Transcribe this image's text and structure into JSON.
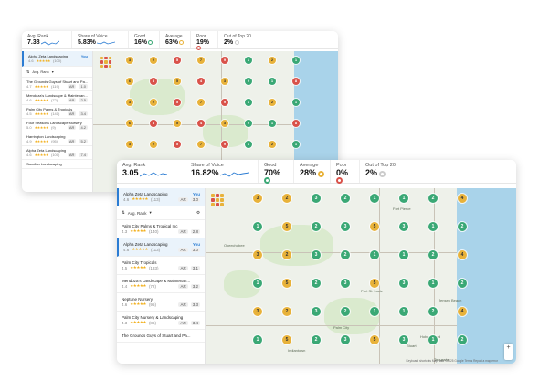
{
  "back": {
    "stats": [
      {
        "label": "Avg. Rank",
        "value": "7.38"
      },
      {
        "label": "Share of Voice",
        "value": "5.83%"
      },
      {
        "label": "Good",
        "value": "16%"
      },
      {
        "label": "Average",
        "value": "63%"
      },
      {
        "label": "Poor",
        "value": "19%"
      },
      {
        "label": "Out of Top 20",
        "value": "2%"
      }
    ],
    "selected": {
      "name": "Alpha Zeta Landscaping",
      "you": "You",
      "rating": "4.6",
      "reviews": "(100)"
    },
    "sort_label": "Avg. Rank",
    "list": [
      {
        "name": "The Grounds Guys of Stuart and Pa...",
        "rating": "4.7",
        "reviews": "(119)",
        "ar": "AR",
        "rank": "1.0"
      },
      {
        "name": "Mendoza's Landscape & Maintenan...",
        "rating": "4.6",
        "reviews": "(72)",
        "ar": "AR",
        "rank": "2.5"
      },
      {
        "name": "Palm City Palms & Tropicals",
        "rating": "4.5",
        "reviews": "(141)",
        "ar": "AR",
        "rank": "3.4"
      },
      {
        "name": "Four Seasons Landscape Nursery",
        "rating": "5.0",
        "reviews": "(9)",
        "ar": "AR",
        "rank": "4.2"
      },
      {
        "name": "Harrington Landscaping",
        "rating": "4.9",
        "reviews": "(95)",
        "ar": "AR",
        "rank": "5.2"
      },
      {
        "name": "Alpha Zeta Landscaping",
        "rating": "4.6",
        "reviews": "(100)",
        "ar": "AR",
        "rank": "7.4"
      },
      {
        "name": "Sarafinn Landscaping",
        "rating": "",
        "reviews": "",
        "ar": "",
        "rank": ""
      }
    ]
  },
  "front": {
    "stats": [
      {
        "label": "Avg. Rank",
        "value": "3.05"
      },
      {
        "label": "Share of Voice",
        "value": "16.82%"
      },
      {
        "label": "Good",
        "value": "70%"
      },
      {
        "label": "Average",
        "value": "28%"
      },
      {
        "label": "Poor",
        "value": "0%"
      },
      {
        "label": "Out of Top 20",
        "value": "2%"
      }
    ],
    "selected": {
      "name": "Alpha Zeta Landscaping",
      "you": "You",
      "rating": "4.6",
      "reviews": "(113)",
      "ar": "AR",
      "rank": "3.0"
    },
    "sort_label": "Avg. Rank",
    "list": [
      {
        "name": "Palm City Palms & Tropical Inc",
        "rating": "4.3",
        "reviews": "(140)",
        "ar": "AR",
        "rank": "2.8",
        "sel": false
      },
      {
        "name": "Alpha Zeta Landscaping",
        "rating": "4.6",
        "reviews": "(113)",
        "ar": "AR",
        "rank": "3.0",
        "sel": true,
        "you": "You"
      },
      {
        "name": "Palm City Tropicals",
        "rating": "4.5",
        "reviews": "(133)",
        "ar": "AR",
        "rank": "3.1",
        "sel": false
      },
      {
        "name": "Mendoza's Landscape & Maintenan...",
        "rating": "4.4",
        "reviews": "(72)",
        "ar": "AR",
        "rank": "3.2",
        "sel": false
      },
      {
        "name": "Neptune Nursery",
        "rating": "4.6",
        "reviews": "(95)",
        "ar": "AR",
        "rank": "3.3",
        "sel": false
      },
      {
        "name": "Palm City Nursery & Landscaping",
        "rating": "4.3",
        "reviews": "(86)",
        "ar": "AR",
        "rank": "3.4",
        "sel": false
      },
      {
        "name": "The Grounds Guys of Stuart and Pa...",
        "rating": "",
        "reviews": "",
        "ar": "",
        "rank": "",
        "sel": false
      }
    ],
    "map_labels": [
      "Fort Pierce",
      "Port St. Lucie",
      "Stuart",
      "Palm City",
      "Indiantown",
      "Jensen Beach",
      "Hobe Sound",
      "Tequesta",
      "Okeechobee"
    ],
    "footer": "Keyboard shortcuts   Map data ©2025 Google   Terms   Report a map error",
    "zoom_in": "+",
    "zoom_out": "−"
  },
  "colors": {
    "good": "#3aa875",
    "average": "#e8b23a",
    "poor": "#d9524a",
    "accent": "#2b7cd3"
  }
}
